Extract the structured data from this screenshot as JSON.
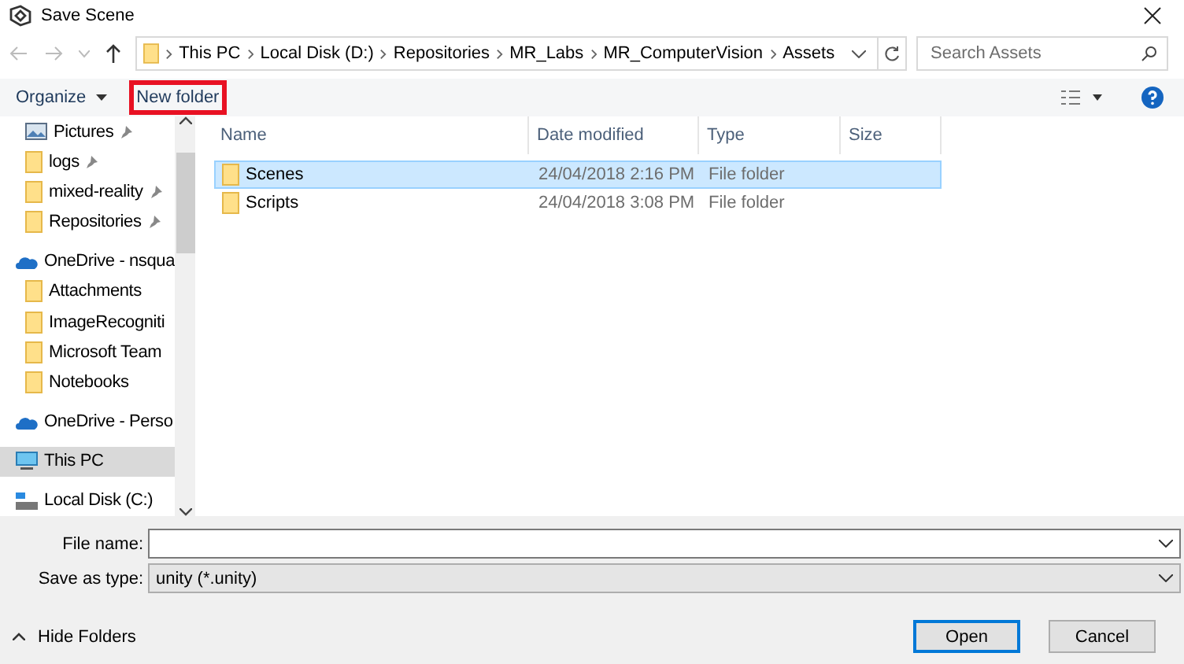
{
  "window": {
    "title": "Save Scene"
  },
  "breadcrumb": [
    "This PC",
    "Local Disk (D:)",
    "Repositories",
    "MR_Labs",
    "MR_ComputerVision",
    "Assets"
  ],
  "search": {
    "placeholder": "Search Assets"
  },
  "toolbar": {
    "organize": "Organize",
    "new_folder": {
      "label": "New folder",
      "highlighted": true
    }
  },
  "sidebar": {
    "items": [
      {
        "kind": "pictures",
        "label": "Pictures",
        "pinned": true,
        "selected": false
      },
      {
        "kind": "folder",
        "label": "logs",
        "pinned": true,
        "selected": false
      },
      {
        "kind": "folder",
        "label": "mixed-reality",
        "pinned": true,
        "selected": false
      },
      {
        "kind": "folder",
        "label": "Repositories",
        "pinned": true,
        "selected": false
      },
      {
        "kind": "cloud",
        "label": "OneDrive - nsqua",
        "selected": false,
        "children": [
          {
            "kind": "folder",
            "label": "Attachments",
            "selected": false
          },
          {
            "kind": "folder",
            "label": "ImageRecogniti",
            "selected": false
          },
          {
            "kind": "folder",
            "label": "Microsoft Team",
            "selected": false
          },
          {
            "kind": "folder",
            "label": "Notebooks",
            "selected": false
          }
        ]
      },
      {
        "kind": "cloud",
        "label": "OneDrive - Perso",
        "selected": false
      },
      {
        "kind": "pc",
        "label": "This PC",
        "selected": true
      },
      {
        "kind": "disk",
        "label": "Local Disk (C:)",
        "selected": false
      }
    ]
  },
  "table": {
    "columns": [
      "Name",
      "Date modified",
      "Type",
      "Size"
    ],
    "rows": [
      {
        "name": "Scenes",
        "date": "24/04/2018 2:16 PM",
        "type": "File folder",
        "selected": true
      },
      {
        "name": "Scripts",
        "date": "24/04/2018 3:08 PM",
        "type": "File folder",
        "selected": false
      }
    ]
  },
  "form": {
    "file_name_label": "File name:",
    "type_label": "Save as type:",
    "type_value": "unity (*.unity)"
  },
  "footer": {
    "hide_folders": "Hide Folders",
    "buttons": [
      "Open",
      "Cancel"
    ]
  }
}
